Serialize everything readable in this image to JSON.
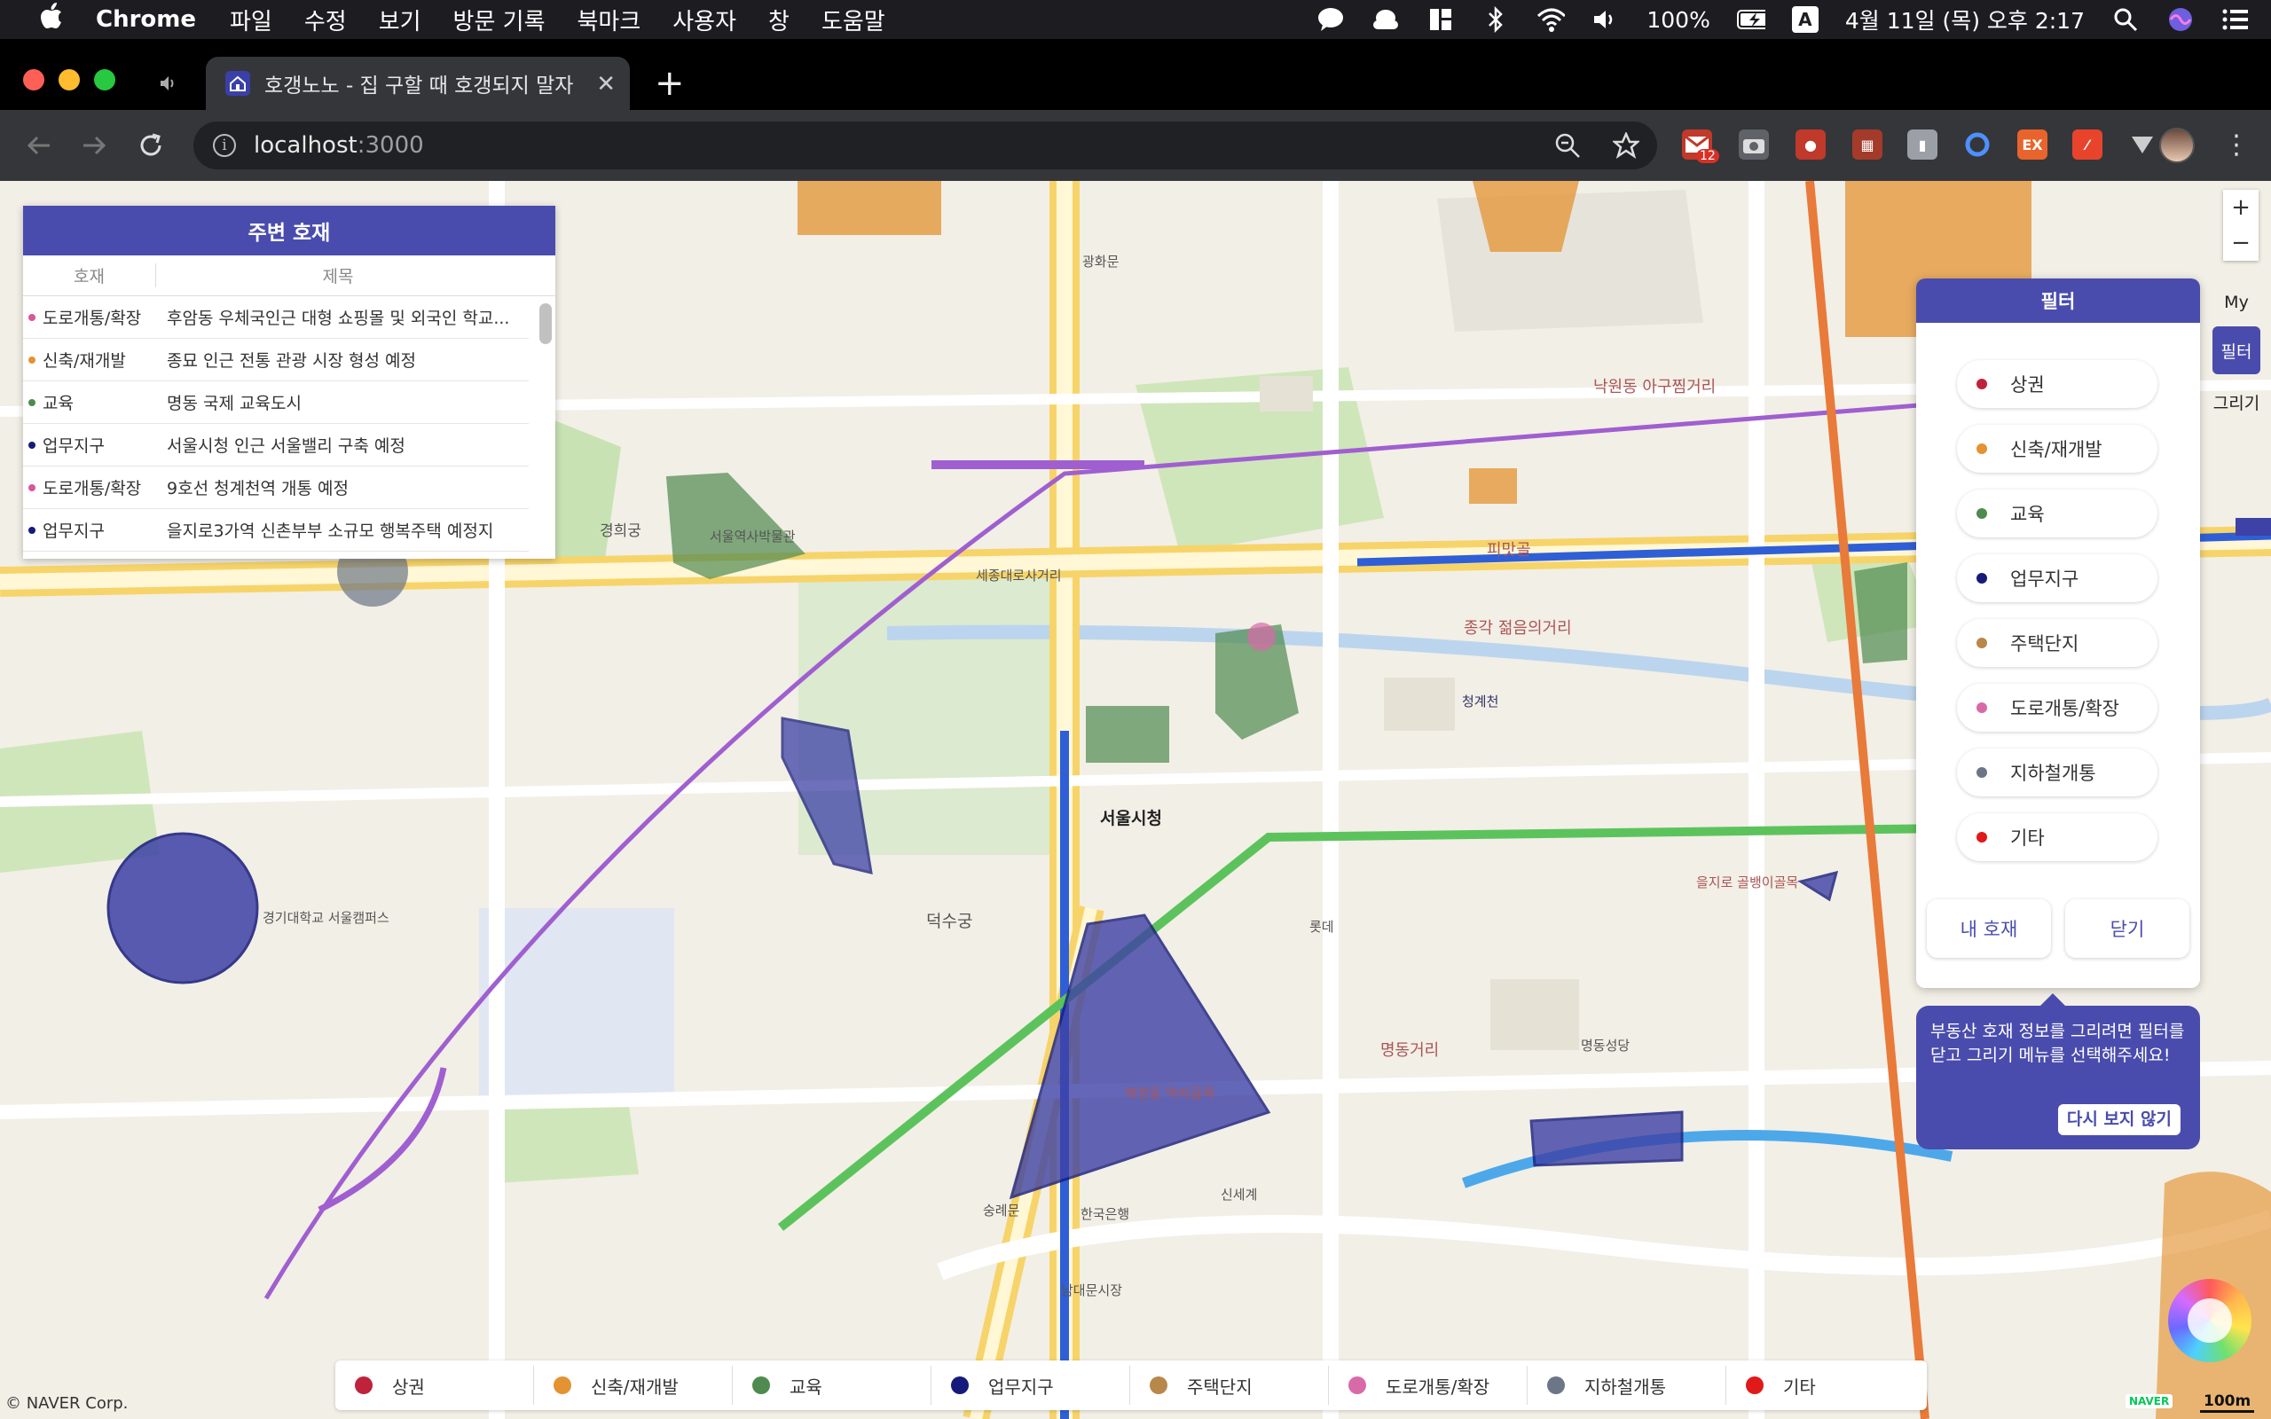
{
  "menubar": {
    "app_name": "Chrome",
    "items": [
      "파일",
      "수정",
      "보기",
      "방문 기록",
      "북마크",
      "사용자",
      "창",
      "도움말"
    ],
    "battery": "100%",
    "input_source": "A",
    "clock": "4월 11일 (목) 오후 2:17"
  },
  "browser": {
    "tab_title": "호갱노노 - 집 구할 때 호갱되지 말자",
    "url_host": "localhost",
    "url_port": ":3000",
    "gmail_badge": "12",
    "ext_ex_label": "EX"
  },
  "nearby_panel": {
    "title": "주변 호재",
    "col_category": "호재",
    "col_title": "제목",
    "rows": [
      {
        "category": "도로개통/확장",
        "color": "#d9559c",
        "title": "후암동 우체국인근 대형 쇼핑몰 및 외국인 학교..."
      },
      {
        "category": "신축/재개발",
        "color": "#e39332",
        "title": "종묘 인근 전통 관광 시장 형성 예정"
      },
      {
        "category": "교육",
        "color": "#4f8a4f",
        "title": "명동 국제 교육도시"
      },
      {
        "category": "업무지구",
        "color": "#161a7a",
        "title": "서울시청 인근 서울밸리 구축 예정"
      },
      {
        "category": "도로개통/확장",
        "color": "#d9559c",
        "title": "9호선 청계천역 개통 예정"
      },
      {
        "category": "업무지구",
        "color": "#161a7a",
        "title": "을지로3가역 신촌부부 소규모 행복주택 예정지"
      }
    ]
  },
  "filter_panel": {
    "title": "필터",
    "items": [
      {
        "label": "상권",
        "color": "#c0223b"
      },
      {
        "label": "신축/재개발",
        "color": "#e39332"
      },
      {
        "label": "교육",
        "color": "#4f8a4f"
      },
      {
        "label": "업무지구",
        "color": "#161a7a"
      },
      {
        "label": "주택단지",
        "color": "#b8874a"
      },
      {
        "label": "도로개통/확장",
        "color": "#d96aa8"
      },
      {
        "label": "지하철개통",
        "color": "#6c7686"
      },
      {
        "label": "기타",
        "color": "#e01919"
      }
    ],
    "my_button": "내 호재",
    "close_button": "닫기"
  },
  "mode_tabs": {
    "my": "My",
    "filter": "필터",
    "draw": "그리기"
  },
  "tooltip": {
    "text": "부동산 호재 정보를 그리려면 필터를 닫고 그리기 메뉴를 선택해주세요!",
    "dismiss": "다시 보지 않기"
  },
  "legend": [
    {
      "label": "상권",
      "color": "#c0223b"
    },
    {
      "label": "신축/재개발",
      "color": "#e39332"
    },
    {
      "label": "교육",
      "color": "#4f8a4f"
    },
    {
      "label": "업무지구",
      "color": "#161a7a"
    },
    {
      "label": "주택단지",
      "color": "#b8874a"
    },
    {
      "label": "도로개통/확장",
      "color": "#d96aa8"
    },
    {
      "label": "지하철개통",
      "color": "#6c7686"
    },
    {
      "label": "기타",
      "color": "#e01919"
    }
  ],
  "map": {
    "copyright": "© NAVER Corp.",
    "scale": "100m",
    "naver": "NAVER",
    "labels": [
      {
        "text": "서울시청",
        "big": true
      },
      {
        "text": "덕수궁",
        "big": false
      },
      {
        "text": "청계천",
        "big": false
      },
      {
        "text": "명동거리",
        "big": false
      },
      {
        "text": "북창동 먹자골목",
        "big": false
      },
      {
        "text": "을지로 골뱅이골목",
        "big": false
      },
      {
        "text": "서울역사박물관",
        "big": false
      },
      {
        "text": "경희궁",
        "big": false
      },
      {
        "text": "종각 젊음의거리",
        "big": false
      },
      {
        "text": "피맛골",
        "big": false
      },
      {
        "text": "낙원동 아구찜거리",
        "big": false
      },
      {
        "text": "광화문",
        "big": false
      },
      {
        "text": "롯데",
        "big": false
      },
      {
        "text": "남대문시장",
        "big": false
      },
      {
        "text": "신세계",
        "big": false
      },
      {
        "text": "숭례문",
        "big": false
      },
      {
        "text": "한국은행",
        "big": false
      },
      {
        "text": "세종대로사거리",
        "big": false
      },
      {
        "text": "경기대학교 서울캠퍼스",
        "big": false
      },
      {
        "text": "명동성당",
        "big": false
      }
    ]
  }
}
